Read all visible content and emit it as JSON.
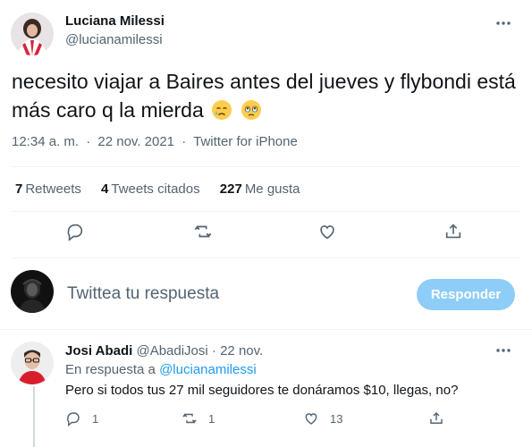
{
  "main_tweet": {
    "author": {
      "name": "Luciana Milessi",
      "handle": "@lucianamilessi"
    },
    "text": "necesito viajar a Baires antes del jueves y flybondi está más caro q la mierda",
    "emojis": [
      "crying-face",
      "face-holding-back-tears"
    ],
    "time": "12:34 a. m.",
    "separator": "·",
    "date": "22 nov. 2021",
    "source": "Twitter for iPhone",
    "stats": {
      "retweets_count": "7",
      "retweets_label": "Retweets",
      "quotes_count": "4",
      "quotes_label": "Tweets citados",
      "likes_count": "227",
      "likes_label": "Me gusta"
    },
    "actions": [
      "reply-icon",
      "retweet-icon",
      "like-icon",
      "share-icon"
    ]
  },
  "reply_box": {
    "placeholder": "Twittea tu respuesta",
    "button_label": "Responder",
    "button_color": "#8ecdf8"
  },
  "reply_tweet": {
    "author": {
      "name": "Josi Abadi",
      "handle": "@AbadiJosi"
    },
    "separator": "·",
    "date": "22 nov.",
    "replying_to_label": "En respuesta a",
    "replying_to_mention": "@lucianamilessi",
    "text": "Pero si todos tus 27 mil seguidores te donáramos $10, llegas, no?",
    "reply_count": "1",
    "retweet_count": "1",
    "like_count": "13"
  },
  "colors": {
    "accent": "#1d9bf0",
    "secondary_text": "#536471",
    "divider": "#eff3f4"
  }
}
